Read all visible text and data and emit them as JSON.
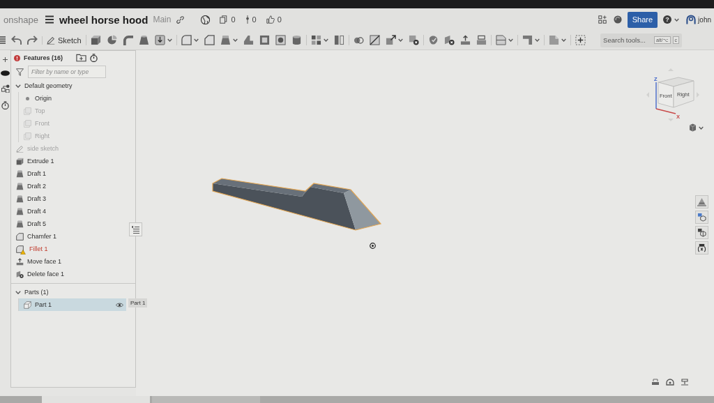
{
  "header": {
    "logo": "onshape",
    "title": "wheel horse hood",
    "workspace": "Main",
    "stats": [
      {
        "kind": "copies",
        "value": "0"
      },
      {
        "kind": "branches",
        "value": "0"
      },
      {
        "kind": "likes",
        "value": "0"
      }
    ],
    "share": "Share",
    "help": "?",
    "user": "john"
  },
  "toolbar": {
    "groups": [
      [
        {
          "kind": "undo",
          "dropdown": false
        },
        {
          "kind": "redo",
          "dropdown": false
        }
      ],
      [
        {
          "kind": "sketch",
          "label": "Sketch",
          "dropdown": false
        }
      ],
      [
        {
          "kind": "extrude",
          "dropdown": false
        },
        {
          "kind": "revolve",
          "dropdown": false
        },
        {
          "kind": "sweep",
          "dropdown": false
        },
        {
          "kind": "loft",
          "dropdown": false
        },
        {
          "kind": "thicken",
          "dropdown": true
        }
      ],
      [
        {
          "kind": "fillet",
          "dropdown": true
        },
        {
          "kind": "chamfer",
          "dropdown": false
        },
        {
          "kind": "draft",
          "dropdown": true
        },
        {
          "kind": "rib",
          "dropdown": false
        },
        {
          "kind": "shell",
          "dropdown": false
        },
        {
          "kind": "hole",
          "dropdown": false
        },
        {
          "kind": "thread",
          "dropdown": false
        }
      ],
      [
        {
          "kind": "pattern",
          "dropdown": true
        },
        {
          "kind": "mirror",
          "dropdown": false
        }
      ],
      [
        {
          "kind": "boolean",
          "dropdown": false
        },
        {
          "kind": "split",
          "dropdown": false
        },
        {
          "kind": "transform",
          "dropdown": true
        },
        {
          "kind": "delete-part",
          "dropdown": false
        }
      ],
      [
        {
          "kind": "modify-fillet",
          "dropdown": false
        },
        {
          "kind": "delete-face",
          "dropdown": false
        },
        {
          "kind": "move-face",
          "dropdown": false
        },
        {
          "kind": "replace-face",
          "dropdown": false
        }
      ],
      [
        {
          "kind": "sheet",
          "dropdown": true
        }
      ],
      [
        {
          "kind": "frame",
          "dropdown": true
        }
      ],
      [
        {
          "kind": "surface",
          "dropdown": true
        }
      ],
      [
        {
          "kind": "custom",
          "dropdown": false
        }
      ]
    ],
    "search": {
      "placeholder": "Search tools...",
      "keys": [
        "alt/⌥",
        "c"
      ]
    }
  },
  "features": {
    "title": "Features (16)",
    "filter": {
      "placeholder": "Filter by name or type"
    },
    "tree": [
      {
        "label": "Default geometry",
        "kind": "folder",
        "expanded": true,
        "selected": false,
        "hidden": false,
        "error": false,
        "children": [
          {
            "label": "Origin",
            "kind": "origin",
            "selected": false,
            "hidden": false,
            "error": false
          },
          {
            "label": "Top",
            "kind": "plane",
            "selected": false,
            "hidden": true,
            "error": false
          },
          {
            "label": "Front",
            "kind": "plane",
            "selected": false,
            "hidden": true,
            "error": false
          },
          {
            "label": "Right",
            "kind": "plane",
            "selected": false,
            "hidden": true,
            "error": false
          }
        ]
      },
      {
        "label": "side sketch",
        "kind": "sketch",
        "selected": false,
        "hidden": true,
        "error": false
      },
      {
        "label": "Extrude 1",
        "kind": "extrude",
        "selected": false,
        "hidden": false,
        "error": false
      },
      {
        "label": "Draft 1",
        "kind": "draft",
        "selected": false,
        "hidden": false,
        "error": false
      },
      {
        "label": "Draft 2",
        "kind": "draft",
        "selected": false,
        "hidden": false,
        "error": false
      },
      {
        "label": "Draft 3",
        "kind": "draft",
        "selected": false,
        "hidden": false,
        "error": false
      },
      {
        "label": "Draft 4",
        "kind": "draft",
        "selected": false,
        "hidden": false,
        "error": false
      },
      {
        "label": "Draft 5",
        "kind": "draft",
        "selected": false,
        "hidden": false,
        "error": false
      },
      {
        "label": "Chamfer 1",
        "kind": "chamfer",
        "selected": false,
        "hidden": false,
        "error": false
      },
      {
        "label": "Fillet 1",
        "kind": "fillet",
        "selected": false,
        "hidden": false,
        "error": true
      },
      {
        "label": "Move face 1",
        "kind": "move-face",
        "selected": false,
        "hidden": false,
        "error": false
      },
      {
        "label": "Delete face 1",
        "kind": "delete-face",
        "selected": false,
        "hidden": false,
        "error": false
      }
    ],
    "parts": [
      {
        "label": "Parts (1)",
        "kind": "folder",
        "expanded": true,
        "selected": false,
        "hidden": false,
        "error": false,
        "children": [
          {
            "label": "Part 1",
            "kind": "part",
            "selected": true,
            "hidden": false,
            "error": false
          }
        ]
      }
    ],
    "tooltip": "Part 1"
  },
  "view_cube": {
    "axes": [
      "Z",
      "X"
    ],
    "faces": [
      "Front",
      "Right"
    ]
  },
  "document_tabs": [
    {
      "selected": true
    },
    {
      "selected": false
    }
  ]
}
